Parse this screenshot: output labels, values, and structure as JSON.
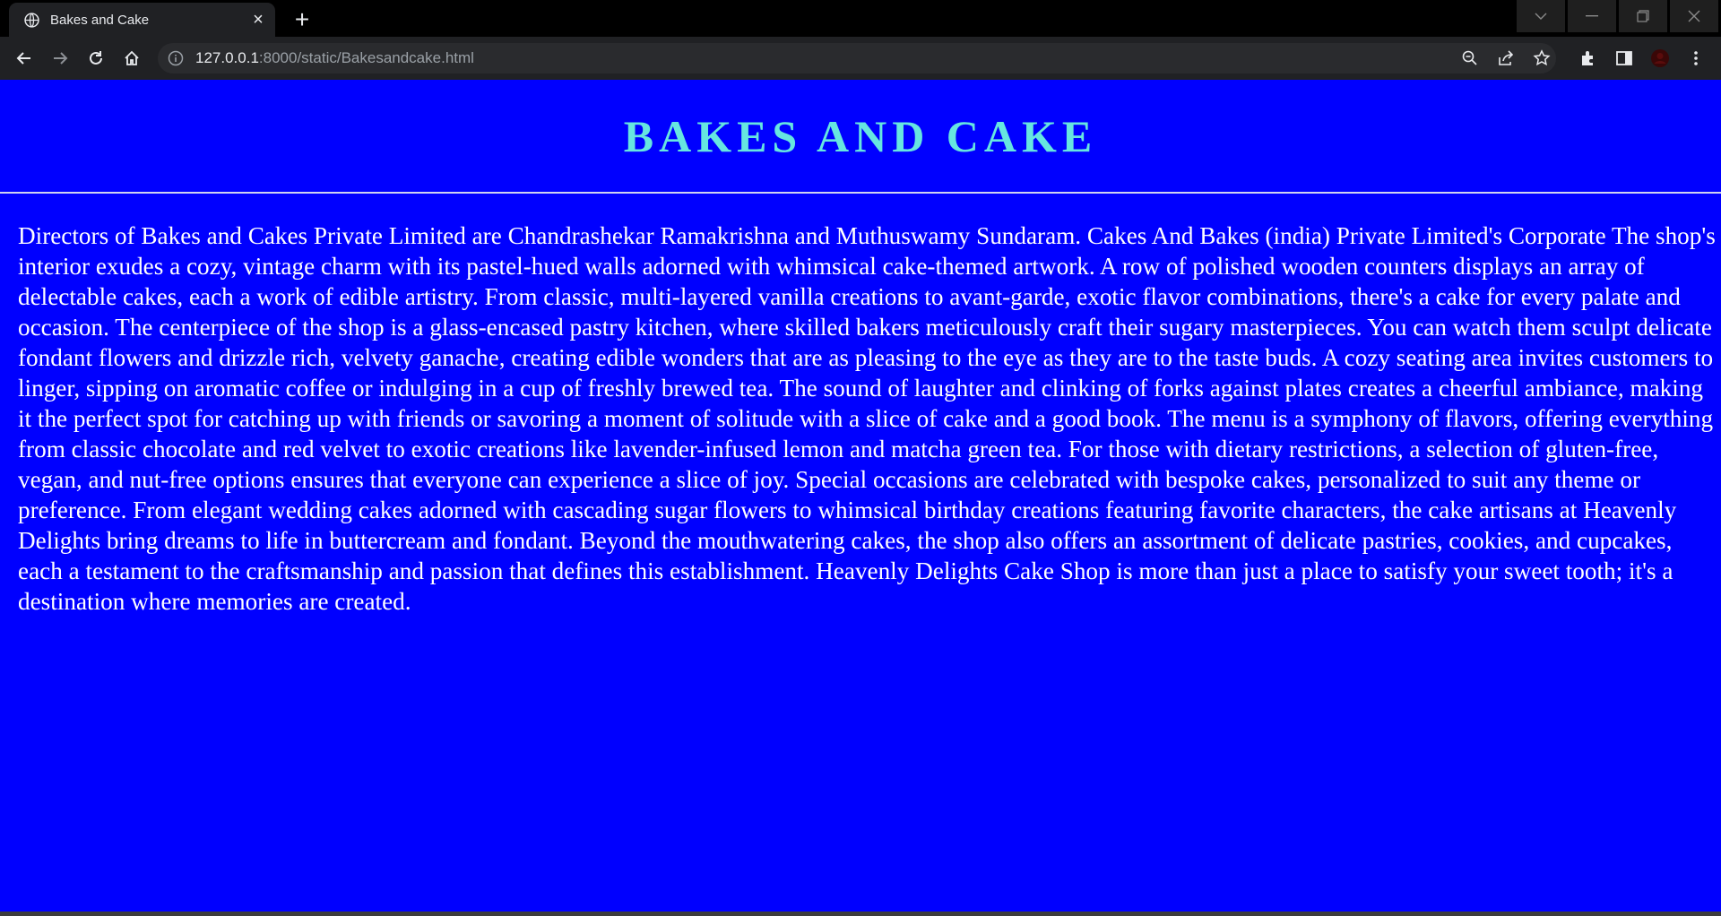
{
  "browser": {
    "tab": {
      "title": "Bakes and Cake",
      "close_label": "×"
    },
    "new_tab_label": "+",
    "url": {
      "host": "127.0.0.1",
      "path": ":8000/static/Bakesandcake.html"
    }
  },
  "page": {
    "heading": "BAKES AND CAKE",
    "body": "Directors of Bakes and Cakes Private Limited are Chandrashekar Ramakrishna and Muthuswamy Sundaram. Cakes And Bakes (india) Private Limited's Corporate The shop's interior exudes a cozy, vintage charm with its pastel-hued walls adorned with whimsical cake-themed artwork. A row of polished wooden counters displays an array of delectable cakes, each a work of edible artistry. From classic, multi-layered vanilla creations to avant-garde, exotic flavor combinations, there's a cake for every palate and occasion. The centerpiece of the shop is a glass-encased pastry kitchen, where skilled bakers meticulously craft their sugary masterpieces. You can watch them sculpt delicate fondant flowers and drizzle rich, velvety ganache, creating edible wonders that are as pleasing to the eye as they are to the taste buds. A cozy seating area invites customers to linger, sipping on aromatic coffee or indulging in a cup of freshly brewed tea. The sound of laughter and clinking of forks against plates creates a cheerful ambiance, making it the perfect spot for catching up with friends or savoring a moment of solitude with a slice of cake and a good book. The menu is a symphony of flavors, offering everything from classic chocolate and red velvet to exotic creations like lavender-infused lemon and matcha green tea. For those with dietary restrictions, a selection of gluten-free, vegan, and nut-free options ensures that everyone can experience a slice of joy. Special occasions are celebrated with bespoke cakes, personalized to suit any theme or preference. From elegant wedding cakes adorned with cascading sugar flowers to whimsical birthday creations featuring favorite characters, the cake artisans at Heavenly Delights bring dreams to life in buttercream and fondant. Beyond the mouthwatering cakes, the shop also offers an assortment of delicate pastries, cookies, and cupcakes, each a testament to the craftsmanship and passion that defines this establishment. Heavenly Delights Cake Shop is more than just a place to satisfy your sweet tooth; it's a destination where memories are created."
  },
  "colors": {
    "page_background": "#0000ff",
    "heading": "#66e6e0",
    "body_text": "#ffffff",
    "browser_frame": "#202124"
  },
  "icons": [
    "globe-icon",
    "close-icon",
    "plus-icon",
    "chevron-down-icon",
    "minimize-icon",
    "restore-icon",
    "window-close-icon",
    "back-icon",
    "forward-icon",
    "reload-icon",
    "home-icon",
    "info-icon",
    "zoom-icon",
    "share-icon",
    "star-icon",
    "extensions-icon",
    "side-panel-icon",
    "profile-icon",
    "menu-icon"
  ]
}
